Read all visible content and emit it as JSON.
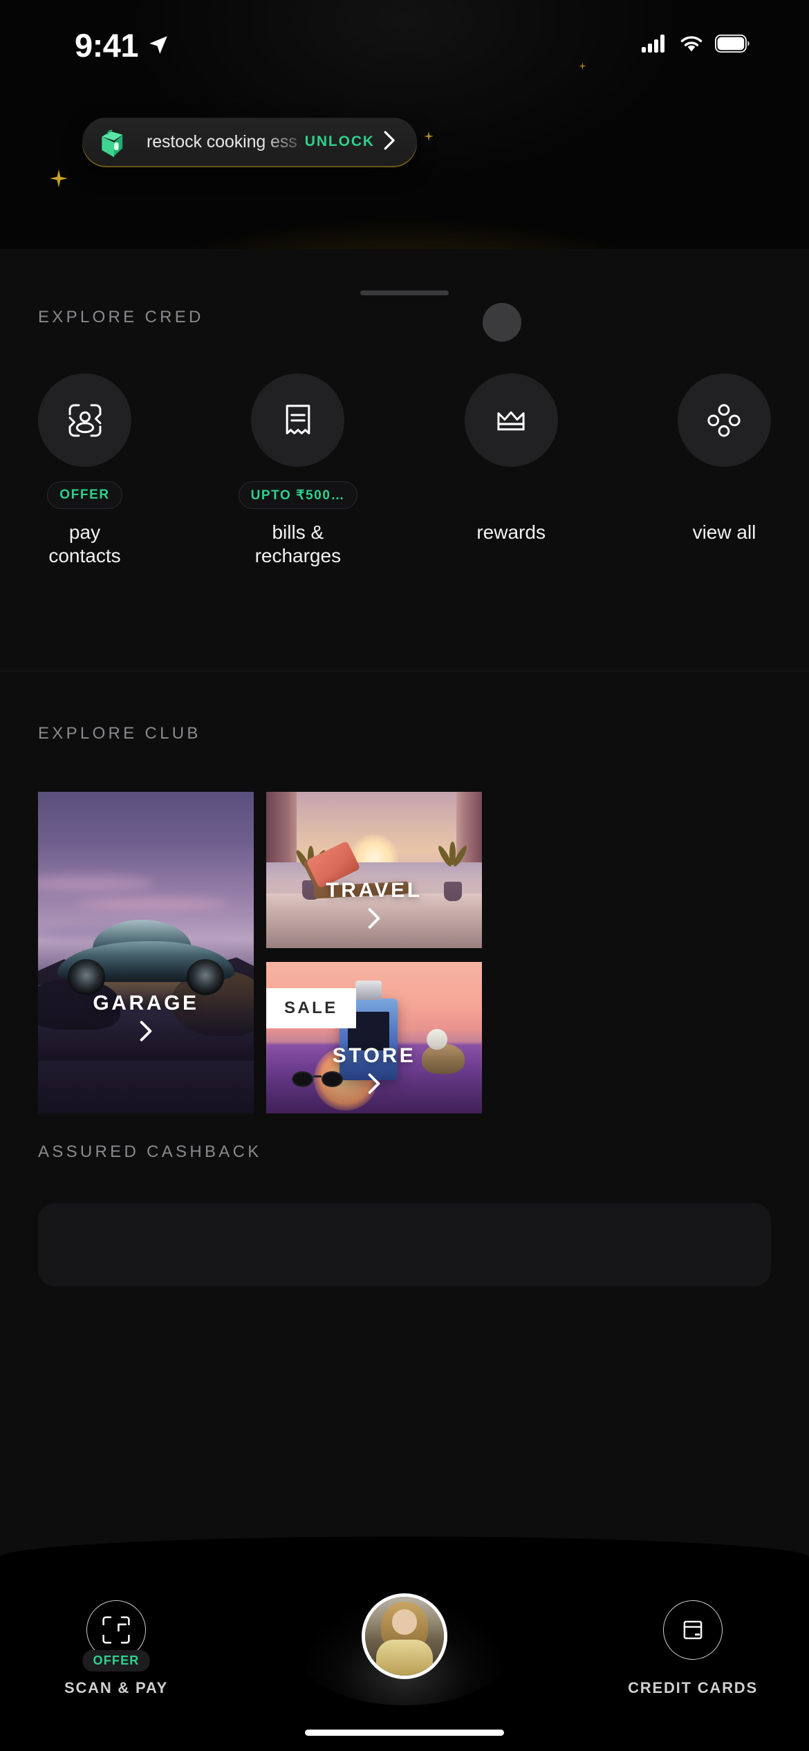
{
  "status_bar": {
    "time": "9:41",
    "location_icon": "location-arrow-icon",
    "cellular_icon": "cellular-bars-icon",
    "wifi_icon": "wifi-icon",
    "battery_icon": "battery-full-icon"
  },
  "offer_banner": {
    "icon": "shopping-bag-icon",
    "text": "restock cooking ess",
    "cta_label": "UNLOCK",
    "cta_chevron": "chevron-right-icon",
    "accent_color": "#2fd18c",
    "border_color": "#caa12a"
  },
  "explore_cred": {
    "section_title": "EXPLORE CRED",
    "items": [
      {
        "icon": "pay-contacts-icon",
        "badge": "OFFER",
        "label": "pay\ncontacts"
      },
      {
        "icon": "receipt-icon",
        "badge": "UPTO ₹500…",
        "label": "bills &\nrecharges"
      },
      {
        "icon": "crown-icon",
        "badge": "",
        "label": "rewards"
      },
      {
        "icon": "four-dots-icon",
        "badge": "",
        "label": "view all"
      }
    ]
  },
  "explore_club": {
    "section_title": "EXPLORE CLUB",
    "cards": [
      {
        "name": "garage",
        "title": "GARAGE",
        "chevron": "chevron-right-icon",
        "badge": ""
      },
      {
        "name": "travel",
        "title": "TRAVEL",
        "chevron": "chevron-right-icon",
        "badge": ""
      },
      {
        "name": "store",
        "title": "STORE",
        "chevron": "chevron-right-icon",
        "badge": "SALE"
      }
    ]
  },
  "assured_cashback": {
    "section_title": "ASSURED CASHBACK"
  },
  "bottom_nav": {
    "left": {
      "icon": "scan-pay-icon",
      "badge": "OFFER",
      "label": "SCAN & PAY"
    },
    "center": {
      "icon": "profile-avatar",
      "label": ""
    },
    "right": {
      "icon": "credit-card-icon",
      "badge": "",
      "label": "CREDIT CARDS"
    }
  }
}
